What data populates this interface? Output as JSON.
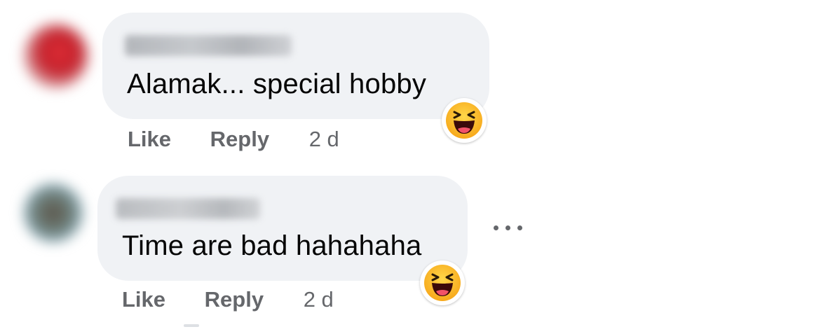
{
  "comments": [
    {
      "text": "Alamak... special hobby",
      "actions": {
        "like": "Like",
        "reply": "Reply",
        "time": "2 d"
      },
      "reaction": "laughing-emoji"
    },
    {
      "text": "Time are bad hahahaha",
      "actions": {
        "like": "Like",
        "reply": "Reply",
        "time": "2 d"
      },
      "reaction": "laughing-emoji"
    }
  ],
  "colors": {
    "bubble": "#f0f2f5",
    "text": "#050505",
    "meta": "#65676b",
    "emoji_face": "#f7b125"
  },
  "icons": {
    "more_options": "more-horizontal-icon"
  }
}
